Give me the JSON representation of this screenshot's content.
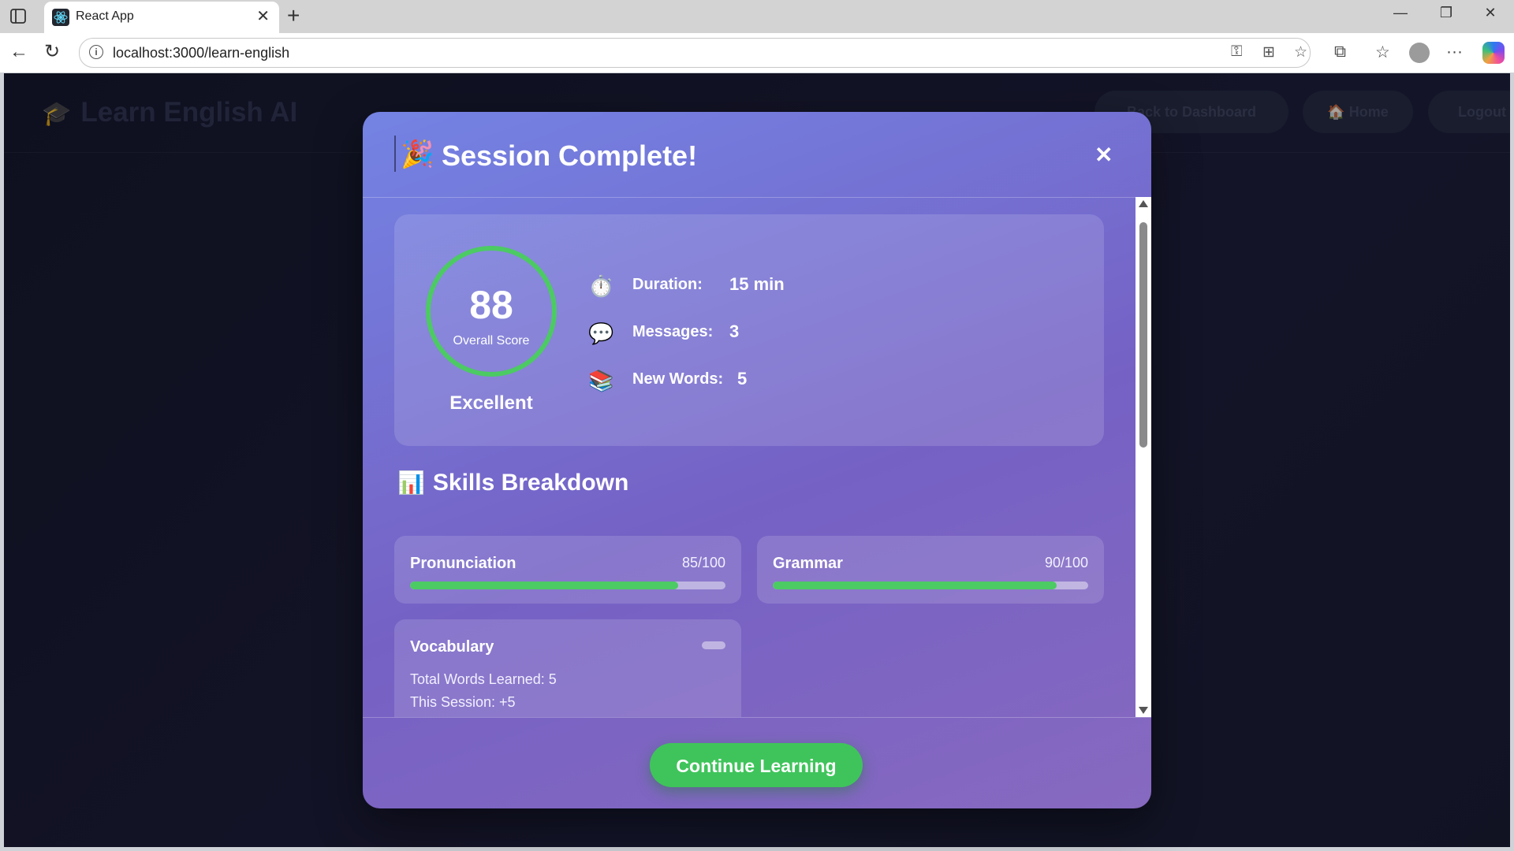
{
  "browser": {
    "tab_title": "React App",
    "url": "localhost:3000/learn-english"
  },
  "app": {
    "brand": "Learn English AI",
    "nav": {
      "back_to_dashboard": "Back to Dashboard",
      "home": "🏠 Home",
      "logout": "Logout"
    }
  },
  "modal": {
    "title": "Session Complete!",
    "close": "✕",
    "score": {
      "value": "88",
      "label": "Overall Score",
      "rating": "Excellent"
    },
    "stats": [
      {
        "icon": "stopwatch-icon",
        "glyph": "⏱️",
        "label": "Duration:",
        "value": "15 min"
      },
      {
        "icon": "speech-bubble-icon",
        "glyph": "💬",
        "label": "Messages:",
        "value": "3"
      },
      {
        "icon": "books-icon",
        "glyph": "📚",
        "label": "New Words:",
        "value": "5"
      }
    ],
    "skills_heading": "Skills Breakdown",
    "skills": [
      {
        "name": "Pronunciation",
        "score": "85/100",
        "progress": 0.85
      },
      {
        "name": "Grammar",
        "score": "90/100",
        "progress": 0.9
      }
    ],
    "vocabulary": {
      "name": "Vocabulary",
      "total_line": "Total Words Learned: 5",
      "session_line": "This Session: +5"
    },
    "continue_button": "Continue Learning"
  },
  "colors": {
    "accent_green": "#4cca63",
    "modal_gradient_start": "#7483e3",
    "modal_gradient_end": "#8769c0"
  }
}
